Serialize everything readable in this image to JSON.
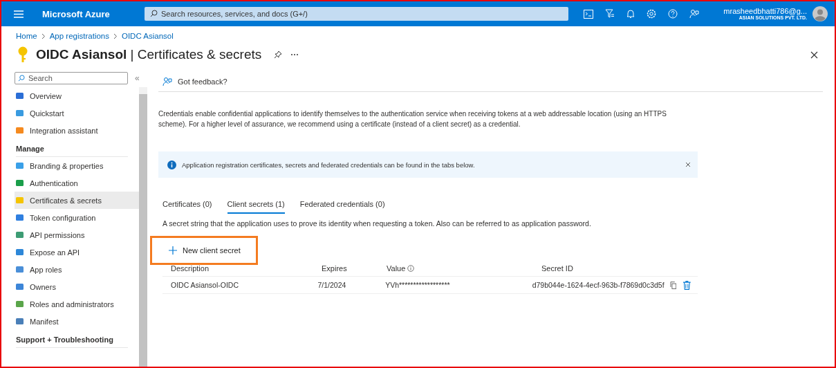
{
  "topbar": {
    "brand": "Microsoft Azure",
    "search": {
      "placeholder": "Search resources, services, and docs (G+/)"
    },
    "account": {
      "email": "mrasheedbhatti786@g...",
      "org": "ASIAN SOLUTIONS PVT. LTD."
    }
  },
  "breadcrumb": [
    "Home",
    "App registrations",
    "OIDC Asiansol"
  ],
  "title": {
    "app": "OIDC Asiansol",
    "separator": "|",
    "page": "Certificates & secrets"
  },
  "sidebar": {
    "search": {
      "placeholder": "Search"
    },
    "collapse": "«",
    "items": [
      {
        "kind": "item",
        "label": "Overview",
        "selected": false
      },
      {
        "kind": "item",
        "label": "Quickstart",
        "selected": false
      },
      {
        "kind": "item",
        "label": "Integration assistant",
        "selected": false
      },
      {
        "kind": "header",
        "label": "Manage"
      },
      {
        "kind": "item",
        "label": "Branding & properties",
        "selected": false
      },
      {
        "kind": "item",
        "label": "Authentication",
        "selected": false
      },
      {
        "kind": "item",
        "label": "Certificates & secrets",
        "selected": true
      },
      {
        "kind": "item",
        "label": "Token configuration",
        "selected": false
      },
      {
        "kind": "item",
        "label": "API permissions",
        "selected": false
      },
      {
        "kind": "item",
        "label": "Expose an API",
        "selected": false
      },
      {
        "kind": "item",
        "label": "App roles",
        "selected": false
      },
      {
        "kind": "item",
        "label": "Owners",
        "selected": false
      },
      {
        "kind": "item",
        "label": "Roles and administrators",
        "selected": false
      },
      {
        "kind": "item",
        "label": "Manifest",
        "selected": false
      },
      {
        "kind": "header",
        "label": "Support + Troubleshooting"
      }
    ]
  },
  "feedback": "Got feedback?",
  "intro": "Credentials enable confidential applications to identify themselves to the authentication service when receiving tokens at a web addressable location (using an HTTPS scheme). For a higher level of assurance, we recommend using a certificate (instead of a client secret) as a credential.",
  "info_banner": "Application registration certificates, secrets and federated credentials can be found in the tabs below.",
  "tabs": [
    {
      "label": "Certificates (0)",
      "selected": false
    },
    {
      "label": "Client secrets (1)",
      "selected": true
    },
    {
      "label": "Federated credentials (0)",
      "selected": false
    }
  ],
  "tab_description": "A secret string that the application uses to prove its identity when requesting a token. Also can be referred to as application password.",
  "new_button": {
    "label": "New client secret",
    "highlighted": true
  },
  "table": {
    "columns": [
      "Description",
      "Expires",
      "Value",
      "Secret ID"
    ],
    "rows": [
      {
        "description": "OIDC Asiansol-OIDC",
        "expires": "7/1/2024",
        "value": "YVh******************",
        "secret_id": "d79b044e-1624-4ecf-963b-f7869d0c3d5f"
      }
    ]
  }
}
